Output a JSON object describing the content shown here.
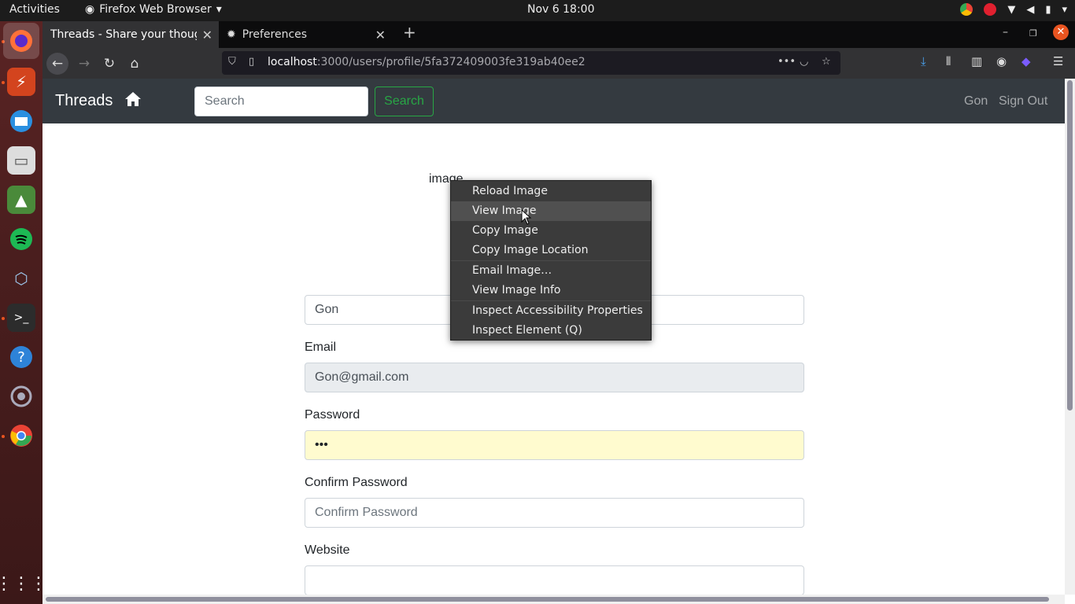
{
  "topbar": {
    "activities": "Activities",
    "app_name": "Firefox Web Browser",
    "clock": "Nov 6  18:00"
  },
  "tabs": [
    {
      "title": "Threads - Share your though",
      "selected": true
    },
    {
      "title": "Preferences",
      "selected": false
    }
  ],
  "urlbar": {
    "host": "localhost",
    "path": ":3000/users/profile/5fa372409003fe319ab40ee2"
  },
  "site": {
    "brand": "Threads",
    "search_placeholder": "Search",
    "search_button": "Search",
    "nav_user": "Gon",
    "nav_signout": "Sign Out"
  },
  "profile": {
    "image_alt": "image",
    "name_value": "Gon",
    "email_label": "Email",
    "email_value": "Gon@gmail.com",
    "password_label": "Password",
    "password_value": "•••",
    "confirm_label": "Confirm Password",
    "confirm_placeholder": "Confirm Password",
    "website_label": "Website",
    "website_value": ""
  },
  "context_menu": {
    "items": [
      "Reload Image",
      "View Image",
      "Copy Image",
      "Copy Image Location",
      "Email Image…",
      "View Image Info",
      "Inspect Accessibility Properties",
      "Inspect Element (Q)"
    ],
    "hovered": "View Image"
  },
  "colors": {
    "site_nav_bg": "#343a40",
    "search_btn": "#28a745",
    "autofill_bg": "#fffbcf",
    "ubuntu_orange": "#e95420"
  }
}
